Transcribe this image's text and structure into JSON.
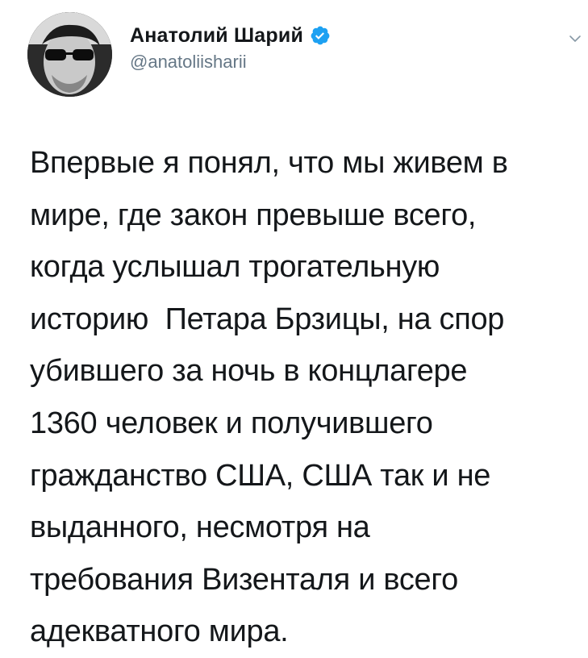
{
  "author": {
    "display_name": "Анатолий Шарий",
    "handle": "@anatoliisharii",
    "verified": true
  },
  "icons": {
    "verified": "verified-badge-icon",
    "more": "chevron-down-icon",
    "avatar": "user-avatar"
  },
  "colors": {
    "verified_badge": "#1da1f2",
    "handle": "#657786",
    "text": "#14171a"
  },
  "tweet": {
    "text": "Впервые я понял, что мы живем в\nмире, где закон превыше всего,\nкогда услышал трогательную\nисторию  Петара Брзицы, на спор\nубившего за ночь в концлагере\n1360 человек и получившего\nгражданство США, США так и не\nвыданного, несмотря на\nтребования Визенталя и всего\nадекватного мира."
  }
}
